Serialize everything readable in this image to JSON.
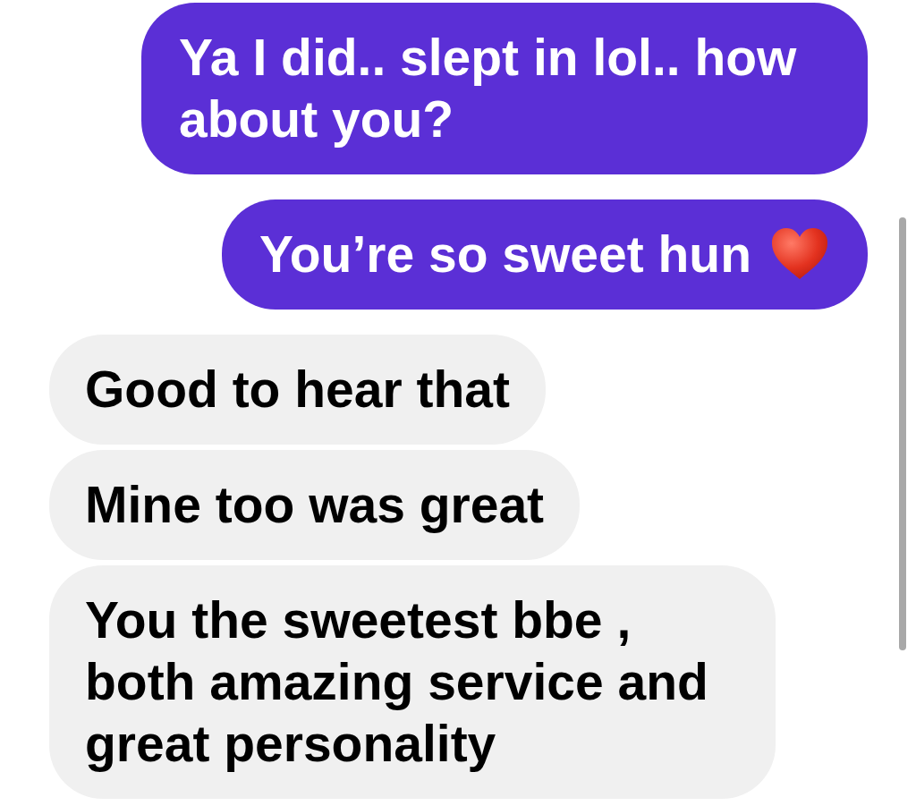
{
  "messages": [
    {
      "outgoing": true,
      "kind": "plain",
      "text": "Ya I did.. slept in lol.. how about you?"
    },
    {
      "outgoing": true,
      "kind": "emoji",
      "text": "You’re so sweet hun"
    },
    {
      "outgoing": false,
      "kind": "plain",
      "text": "Good to hear that"
    },
    {
      "outgoing": false,
      "kind": "plain",
      "text": "Mine too was great"
    },
    {
      "outgoing": false,
      "kind": "plain",
      "text": "You the sweetest bbe , both amazing service and great personality"
    }
  ]
}
